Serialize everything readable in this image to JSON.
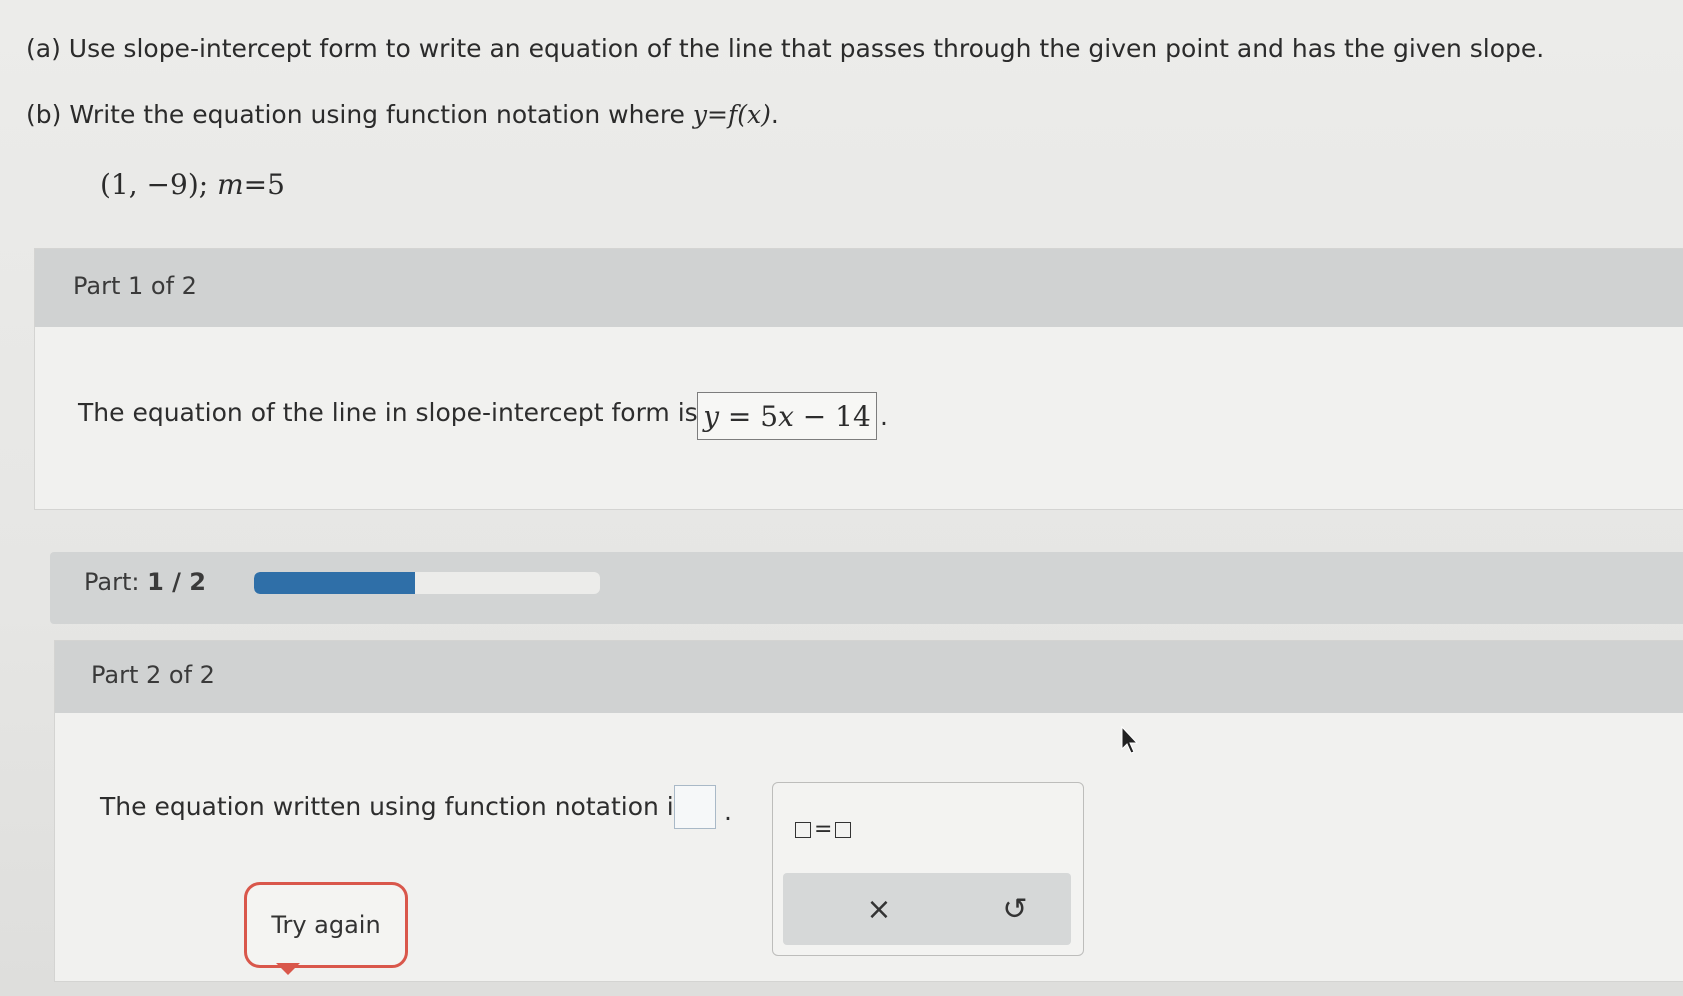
{
  "question": {
    "part_a": "(a) Use slope-intercept form to write an equation of the line that passes through the given point and has the given slope.",
    "part_b_prefix": "(b) Write the equation using function notation where ",
    "part_b_math_y": "y",
    "part_b_math_eq": "=",
    "part_b_math_f": "f",
    "part_b_math_x": "(x)",
    "part_b_suffix": ".",
    "given_point": "(1, −9);",
    "given_slope_var": "m",
    "given_slope_eq": "=5"
  },
  "part1": {
    "header": "Part 1 of 2",
    "text": "The equation of the line in slope-intercept form is",
    "answer_y": "y",
    "answer_rest": " = 5",
    "answer_x": "x",
    "answer_end": " − 14",
    "period": "."
  },
  "progress": {
    "label": "Part:",
    "value": "1 / 2",
    "fraction": 0.5
  },
  "part2": {
    "header": "Part 2 of 2",
    "text": "The equation written using function notation is",
    "input_value": "",
    "period": "."
  },
  "keypad": {
    "equals_template": "=",
    "clear_icon": "close-icon",
    "clear_symbol": "×",
    "undo_icon": "undo-icon",
    "undo_symbol": "↺"
  },
  "try_again_label": "Try again",
  "colors": {
    "progress_fill": "#2f6fa8",
    "try_again_border": "#d9574b",
    "panel_header": "#d0d2d2"
  }
}
